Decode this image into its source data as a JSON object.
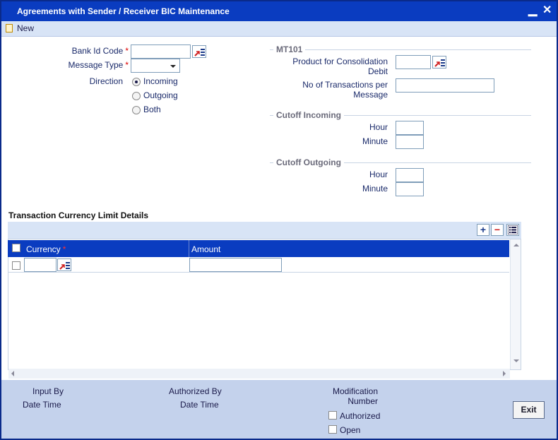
{
  "window": {
    "title": "Agreements with Sender / Receiver BIC Maintenance",
    "minimize": "▁",
    "close": "✕"
  },
  "toolbar": {
    "new_label": "New"
  },
  "form": {
    "bank_id_code": "Bank Id Code",
    "message_type": "Message Type",
    "direction": "Direction",
    "required_marker": "*",
    "direction_options": [
      "Incoming",
      "Outgoing",
      "Both"
    ],
    "selected_direction": "Incoming"
  },
  "mt101": {
    "section": "MT101",
    "product_line1": "Product for Consolidation",
    "product_line2": "Debit",
    "txn_line1": "No of Transactions per",
    "txn_line2": "Message"
  },
  "cutoff_incoming": {
    "section": "Cutoff Incoming",
    "hour": "Hour",
    "minute": "Minute"
  },
  "cutoff_outgoing": {
    "section": "Cutoff Outgoing",
    "hour": "Hour",
    "minute": "Minute"
  },
  "grid": {
    "title": "Transaction Currency Limit Details",
    "add": "+",
    "remove": "−",
    "columns": [
      "Currency",
      "Amount"
    ],
    "required_marker": "*"
  },
  "footer": {
    "input_by": "Input By",
    "date_time_1": "Date Time",
    "authorized_by": "Authorized By",
    "date_time_2": "Date Time",
    "modification_line1": "Modification",
    "modification_line2": "Number",
    "authorized": "Authorized",
    "open": "Open",
    "exit": "Exit"
  }
}
